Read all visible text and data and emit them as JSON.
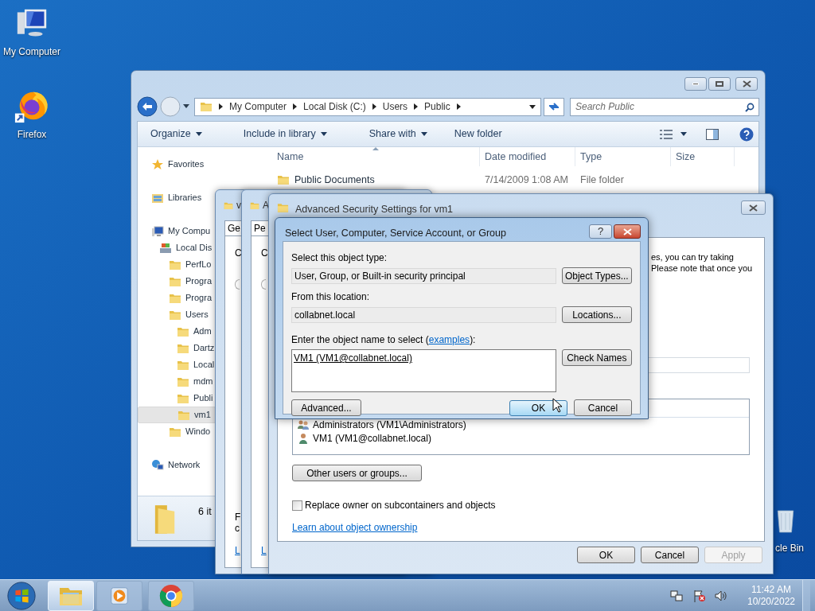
{
  "desktop_icons": [
    {
      "label": "My Computer",
      "kind": "computer"
    },
    {
      "label": "Firefox",
      "kind": "firefox"
    }
  ],
  "recycle_bin": {
    "label": "cle Bin"
  },
  "explorer": {
    "breadcrumb": [
      "My Computer",
      "Local Disk (C:)",
      "Users",
      "Public"
    ],
    "search": {
      "placeholder": "Search Public"
    },
    "toolbar": [
      {
        "label": "Organize",
        "dropdown": true
      },
      {
        "label": "Include in library",
        "dropdown": true
      },
      {
        "label": "Share with",
        "dropdown": true
      },
      {
        "label": "New folder",
        "dropdown": false
      }
    ],
    "nav": [
      {
        "label": "Favorites",
        "kind": "star",
        "selected": false
      },
      {
        "label": "Libraries",
        "kind": "library",
        "selected": false
      },
      {
        "label": "My Compu",
        "kind": "computer",
        "selected": false,
        "children": [
          {
            "label": "Local Dis",
            "kind": "disk",
            "selected": false,
            "children": [
              {
                "label": "PerfLo",
                "kind": "folder",
                "selected": false
              },
              {
                "label": "Progra",
                "kind": "folder",
                "selected": false
              },
              {
                "label": "Progra",
                "kind": "folder",
                "selected": false
              },
              {
                "label": "Users",
                "kind": "folder",
                "selected": false,
                "children": [
                  {
                    "label": "Adm",
                    "kind": "folder",
                    "selected": false
                  },
                  {
                    "label": "Dartz",
                    "kind": "folder",
                    "selected": false
                  },
                  {
                    "label": "Local",
                    "kind": "folder",
                    "selected": false
                  },
                  {
                    "label": "mdm",
                    "kind": "folder",
                    "selected": false
                  },
                  {
                    "label": "Publi",
                    "kind": "folder",
                    "selected": false
                  },
                  {
                    "label": "vm1",
                    "kind": "folder",
                    "selected": true
                  }
                ]
              },
              {
                "label": "Windo",
                "kind": "folder",
                "selected": false
              }
            ]
          }
        ]
      },
      {
        "label": "Network",
        "kind": "network",
        "selected": false
      }
    ],
    "columns": [
      "Name",
      "Date modified",
      "Type",
      "Size"
    ],
    "rows": [
      {
        "name": "Public Documents",
        "date": "7/14/2009 1:08 AM",
        "type": "File folder"
      }
    ],
    "details": "6 it"
  },
  "back_windows": [
    {
      "title": "v",
      "tab": "Ge",
      "text_1": "C",
      "radio": {
        "selected": false
      },
      "text_2": "F",
      "text_3": "c",
      "link": "L"
    },
    {
      "title": "A",
      "tab": "Pe",
      "text_1": "C",
      "radio": {
        "selected": false
      },
      "link": "L"
    }
  ],
  "advanced_security": {
    "title": "Advanced Security Settings for vm1",
    "text_lines": [
      "es, you can try taking",
      "Please note that once you"
    ],
    "owners": [
      {
        "name": "Administrators (VM1\\Administrators)",
        "kind": "group"
      },
      {
        "name": "VM1 (VM1@collabnet.local)",
        "kind": "user"
      }
    ],
    "other_button": "Other users or groups...",
    "replace": {
      "label": "Replace owner on subcontainers and objects",
      "checked": false
    },
    "link": "Learn about object ownership",
    "buttons": [
      {
        "label": "OK",
        "disabled": false
      },
      {
        "label": "Cancel",
        "disabled": false
      },
      {
        "label": "Apply",
        "disabled": true
      }
    ]
  },
  "select_dialog": {
    "title": "Select User, Computer, Service Account, or Group",
    "help": "?",
    "object_type_label": "Select this object type:",
    "object_type": "User, Group, or Built-in security principal",
    "object_types_button": "Object Types...",
    "location_label": "From this location:",
    "location": "collabnet.local",
    "locations_button": "Locations...",
    "name_label_before": "Enter the object name to select (",
    "name_link": "examples",
    "name_label_after": "):",
    "names": "VM1 (VM1@collabnet.local)",
    "check_button": "Check Names",
    "advanced_button": "Advanced...",
    "ok": "OK",
    "cancel": "Cancel"
  },
  "taskbar": {
    "apps": [
      {
        "kind": "explorer",
        "active": true
      },
      {
        "kind": "media",
        "active": false
      },
      {
        "kind": "chrome",
        "active": false
      }
    ],
    "clock": {
      "time": "11:42 AM",
      "date": "10/20/2022"
    }
  }
}
